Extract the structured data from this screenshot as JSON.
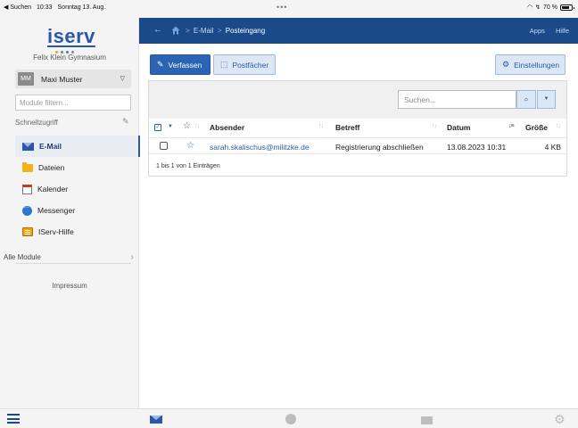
{
  "status_bar": {
    "back_app": "◀ Suchen",
    "time": "10:33",
    "date": "Sonntag 13. Aug.",
    "battery": "70 %"
  },
  "sidebar": {
    "logo": "iserv",
    "school": "Felix Klein Gymnasium",
    "user": {
      "initials": "MM",
      "name": "Maxi Muster"
    },
    "filter_placeholder": "Module filtern...",
    "quick_access_title": "Schnellzugriff",
    "items": [
      {
        "label": "E-Mail",
        "icon": "mail-icon",
        "active": true
      },
      {
        "label": "Dateien",
        "icon": "folder-icon",
        "active": false
      },
      {
        "label": "Kalender",
        "icon": "calendar-icon",
        "active": false
      },
      {
        "label": "Messenger",
        "icon": "chat-icon",
        "active": false
      },
      {
        "label": "IServ-Hilfe",
        "icon": "help-icon",
        "active": false
      }
    ],
    "all_modules": "Alle Module",
    "impressum": "Impressum"
  },
  "header": {
    "breadcrumb": [
      "E-Mail",
      "Posteingang"
    ],
    "links": [
      "Apps",
      "Hilfe"
    ]
  },
  "toolbar": {
    "compose_label": "Verfassen",
    "mailboxes_label": "Postfächer",
    "settings_label": "Einstellungen"
  },
  "search": {
    "placeholder": "Suchen..."
  },
  "table": {
    "columns": [
      "Absender",
      "Betreff",
      "Datum",
      "Größe"
    ],
    "rows": [
      {
        "sender": "sarah.skalischus@militzke.de",
        "subject": "Registrierung abschließen",
        "date": "13.08.2023 10:31",
        "size": "4 KB"
      }
    ],
    "info": "1 bis 1 von 1 Einträgen"
  },
  "colors": {
    "brand_blue": "#1a4a8a",
    "primary_button": "#2b64b5",
    "accent_link": "#2b5ca6"
  }
}
